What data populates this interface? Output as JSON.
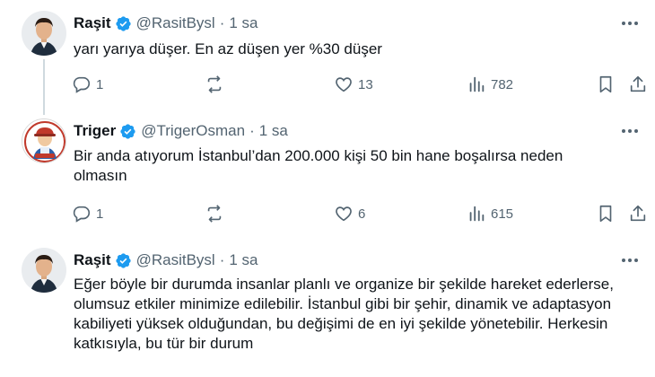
{
  "tweets": [
    {
      "name": "Raşit",
      "handle": "@RasitBysl",
      "dot": "·",
      "time": "1 sa",
      "text": "yarı yarıya düşer. En az düşen yer %30 düşer",
      "replies": "1",
      "retweets": "",
      "likes": "13",
      "views": "782"
    },
    {
      "name": "Triger",
      "handle": "@TrigerOsman",
      "dot": "·",
      "time": "1 sa",
      "text": "Bir anda atıyorum İstanbul’dan 200.000 kişi 50 bin hane boşalırsa neden olmasın",
      "replies": "1",
      "retweets": "",
      "likes": "6",
      "views": "615"
    },
    {
      "name": "Raşit",
      "handle": "@RasitBysl",
      "dot": "·",
      "time": "1 sa",
      "text": "Eğer böyle bir durumda insanlar planlı ve organize bir şekilde hareket ederlerse, olumsuz etkiler minimize edilebilir. İstanbul gibi bir şehir, dinamik ve adaptasyon kabiliyeti yüksek olduğundan, bu değişimi de en iyi şekilde yönetebilir. Herkesin katkısıyla, bu tür bir durum"
    }
  ],
  "colors": {
    "text": "#0f1419",
    "secondary": "#536471",
    "verified": "#1d9bf0",
    "thread_line": "#cfd9de"
  },
  "icons": {
    "verified": "verified-badge-icon",
    "more": "more-dots-icon",
    "reply": "reply-icon",
    "retweet": "retweet-icon",
    "like": "heart-icon",
    "views": "views-chart-icon",
    "bookmark": "bookmark-icon",
    "share": "share-icon"
  }
}
